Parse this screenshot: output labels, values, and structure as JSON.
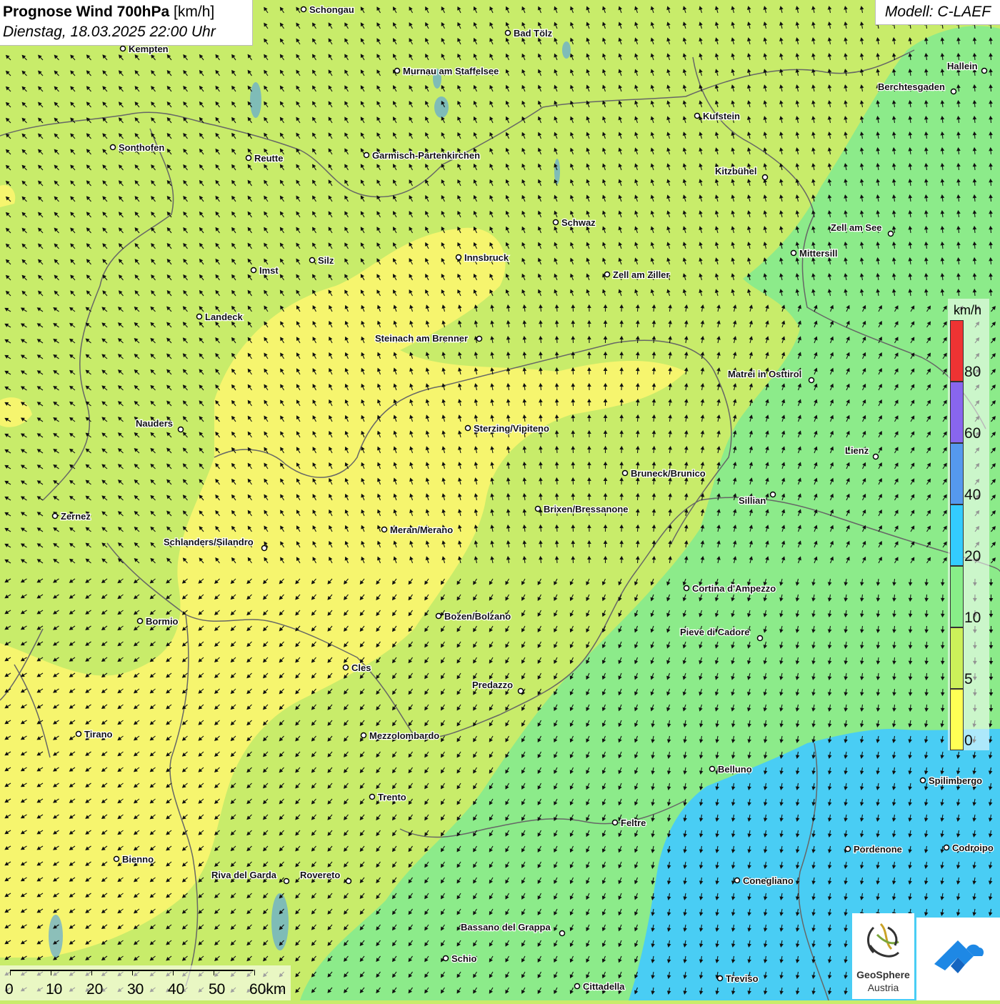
{
  "header": {
    "title_bold": "Prognose Wind 700hPa",
    "title_unit": "[km/h]",
    "datetime": "Dienstag, 18.03.2025 22:00 Uhr",
    "model": "Modell: C-LAEF"
  },
  "legend": {
    "unit": "km/h",
    "bins": [
      {
        "label": "0",
        "color": "#ffff55"
      },
      {
        "label": "5",
        "color": "#ccf05a"
      },
      {
        "label": "10",
        "color": "#88ee88"
      },
      {
        "label": "20",
        "color": "#33ccff"
      },
      {
        "label": "40",
        "color": "#5599ee"
      },
      {
        "label": "60",
        "color": "#8866ee"
      },
      {
        "label": "80",
        "color": "#ee3333"
      }
    ]
  },
  "scale_bar": {
    "labels": [
      "0",
      "10",
      "20",
      "30",
      "40",
      "50",
      "60km"
    ]
  },
  "cities": [
    "Schongau",
    "Bad Tölz",
    "Kempten",
    "Murnau am Staffelsee",
    "Hallein",
    "Berchtesgaden",
    "Kufstein",
    "Sonthofen",
    "Reutte",
    "Garmisch-Partenkirchen",
    "Kitzbühel",
    "Schwaz",
    "Zell am See",
    "Mittersill",
    "Innsbruck",
    "Silz",
    "Imst",
    "Zell am Ziller",
    "Landeck",
    "Steinach am Brenner",
    "Matrei in Osttirol",
    "Nauders",
    "Sterzing/Vipiteno",
    "Lienz",
    "Bruneck/Brunico",
    "Sillian",
    "Brixen/Bressanone",
    "Zernez",
    "Meran/Merano",
    "Schlanders/Silandro",
    "Cortina d'Ampezzo",
    "Bormio",
    "Bozen/Bolzano",
    "Pieve di Cadore",
    "Cles",
    "Predazzo",
    "Tirano",
    "Mezzolombardo",
    "Belluno",
    "Spilimbergo",
    "Trento",
    "Feltre",
    "Pordenone",
    "Codroipo",
    "Bienno",
    "Riva del Garda",
    "Rovereto",
    "Conegliano",
    "Bassano del Grappa",
    "Schio",
    "Treviso",
    "Cittadella"
  ],
  "logo": {
    "line1": "GeoSphere",
    "line2": "Austria"
  },
  "colors": {
    "zone_0": "#f7f56a",
    "zone_5": "#c8ec6a",
    "zone_10": "#8ceb8a",
    "zone_20": "#49cdf4",
    "border": "#666666",
    "lake": "#5fa8d8"
  }
}
